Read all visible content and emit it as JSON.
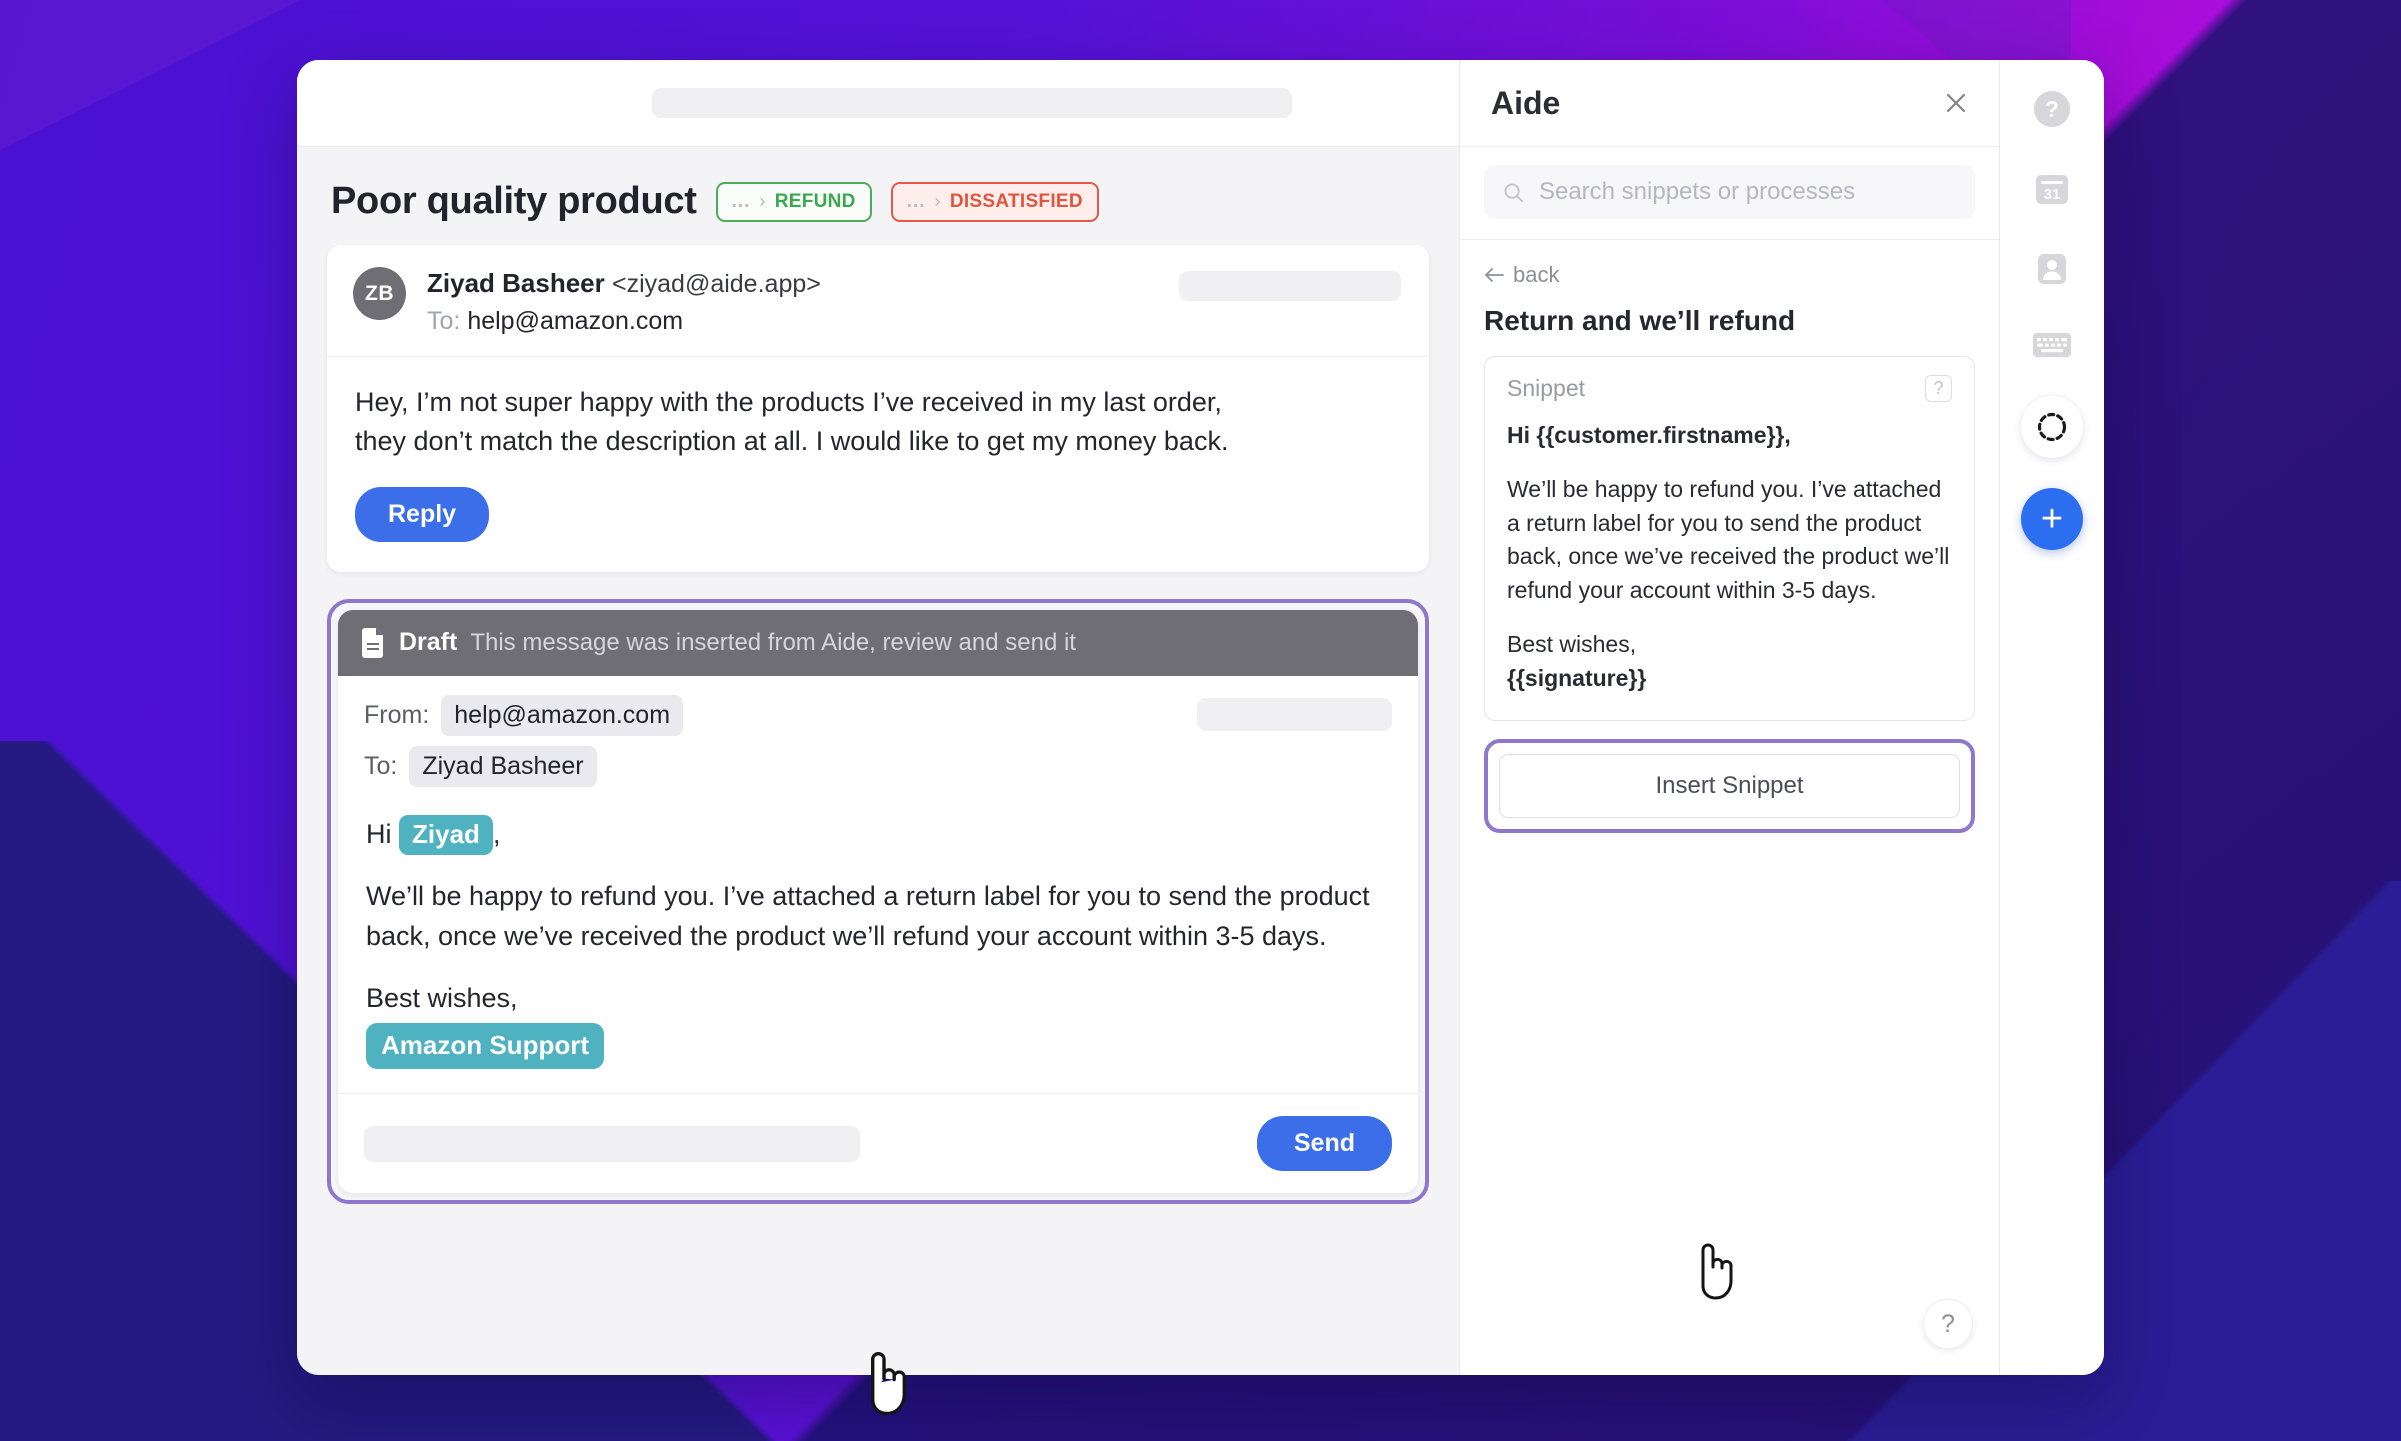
{
  "background": {
    "violet": "#4a11d2",
    "magenta": "#a80dd9",
    "navy": "#241a82"
  },
  "mail": {
    "subject": "Poor quality product",
    "tags": [
      {
        "dots": "...",
        "chevron": "›",
        "label": "REFUND",
        "color": "#3aa84f"
      },
      {
        "dots": "...",
        "chevron": "›",
        "label": "DISSATISFIED",
        "color": "#e0553f"
      }
    ],
    "message": {
      "avatar_initials": "ZB",
      "sender_name": "Ziyad Basheer",
      "sender_email": "<ziyad@aide.app>",
      "to_label": "To:",
      "to_value": "help@amazon.com",
      "body_line1": "Hey, I’m not super happy with the products I’ve received  in my last order,",
      "body_line2": "they don’t match the description at all. I would like to get my money back.",
      "reply_label": "Reply"
    },
    "draft": {
      "badge_label": "Draft",
      "note": "This message was inserted from Aide, review and send it",
      "from_label": "From:",
      "from_value": "help@amazon.com",
      "to_label": "To:",
      "to_value": "Ziyad Basheer",
      "greeting_prefix": "Hi",
      "greeting_chip": "Ziyad",
      "greeting_suffix": ",",
      "body": "We’ll be happy to refund you. I’ve attached a return label for you to send the product back, once we’ve received the product we’ll refund your account within 3-5 days.",
      "closing": "Best wishes,",
      "signature_chip": "Amazon Support",
      "send_label": "Send",
      "chip_color": "#4fb2c0",
      "highlight_color": "#8f77cc"
    }
  },
  "aide": {
    "title": "Aide",
    "close_icon": "close-icon",
    "search_placeholder": "Search snippets or processes",
    "search_value": "",
    "back_label": "back",
    "process_title": "Return and we’ll refund",
    "snippet": {
      "kind_label": "Snippet",
      "help_badge": "?",
      "greeting": "Hi {{customer.firstname}},",
      "body": "We’ll be happy to refund you. I’ve attached a return label for you to send the product back, once we’ve received the product we’ll refund your account within 3-5 days.",
      "closing": "Best wishes,",
      "signature": "{{signature}}"
    },
    "insert_label": "Insert Snippet",
    "help_label": "?"
  },
  "rail": {
    "items": [
      {
        "name": "help-icon",
        "label": "?"
      },
      {
        "name": "calendar-icon",
        "label": "31"
      },
      {
        "name": "contacts-icon",
        "label": ""
      },
      {
        "name": "keyboard-icon",
        "label": ""
      },
      {
        "name": "aide-circle-icon",
        "label": ""
      }
    ],
    "add_label": "+"
  }
}
